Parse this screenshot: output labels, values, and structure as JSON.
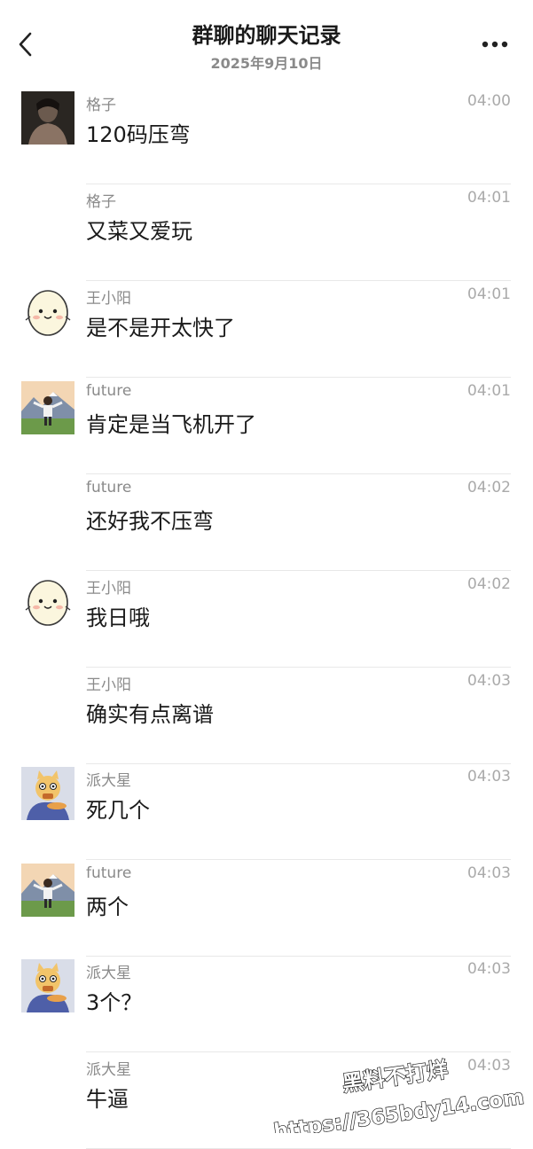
{
  "header": {
    "title": "群聊的聊天记录",
    "date": "2025年9月10日",
    "back_icon": "chevron-left-icon",
    "more_icon": "more-dots-icon"
  },
  "messages": [
    {
      "sender": "格子",
      "time": "04:00",
      "text": "120码压弯",
      "avatar": "photo-man"
    },
    {
      "sender": "格子",
      "time": "04:01",
      "text": "又菜又爱玩",
      "avatar": ""
    },
    {
      "sender": "王小阳",
      "time": "04:01",
      "text": "是不是开太快了",
      "avatar": "egg-cartoon"
    },
    {
      "sender": "future",
      "time": "04:01",
      "text": "肯定是当飞机开了",
      "avatar": "boy-mountain"
    },
    {
      "sender": "future",
      "time": "04:02",
      "text": "还好我不压弯",
      "avatar": ""
    },
    {
      "sender": "王小阳",
      "time": "04:02",
      "text": "我日哦",
      "avatar": "egg-cartoon"
    },
    {
      "sender": "王小阳",
      "time": "04:03",
      "text": "确实有点离谱",
      "avatar": ""
    },
    {
      "sender": "派大星",
      "time": "04:03",
      "text": "死几个",
      "avatar": "cartoon-cat"
    },
    {
      "sender": "future",
      "time": "04:03",
      "text": "两个",
      "avatar": "boy-mountain"
    },
    {
      "sender": "派大星",
      "time": "04:03",
      "text": "3个？",
      "avatar": "cartoon-cat"
    },
    {
      "sender": "派大星",
      "time": "04:03",
      "text": "牛逼",
      "avatar": ""
    }
  ],
  "watermark": {
    "line1": "黑料不打烊",
    "line2": "https://365bdy14.com"
  }
}
